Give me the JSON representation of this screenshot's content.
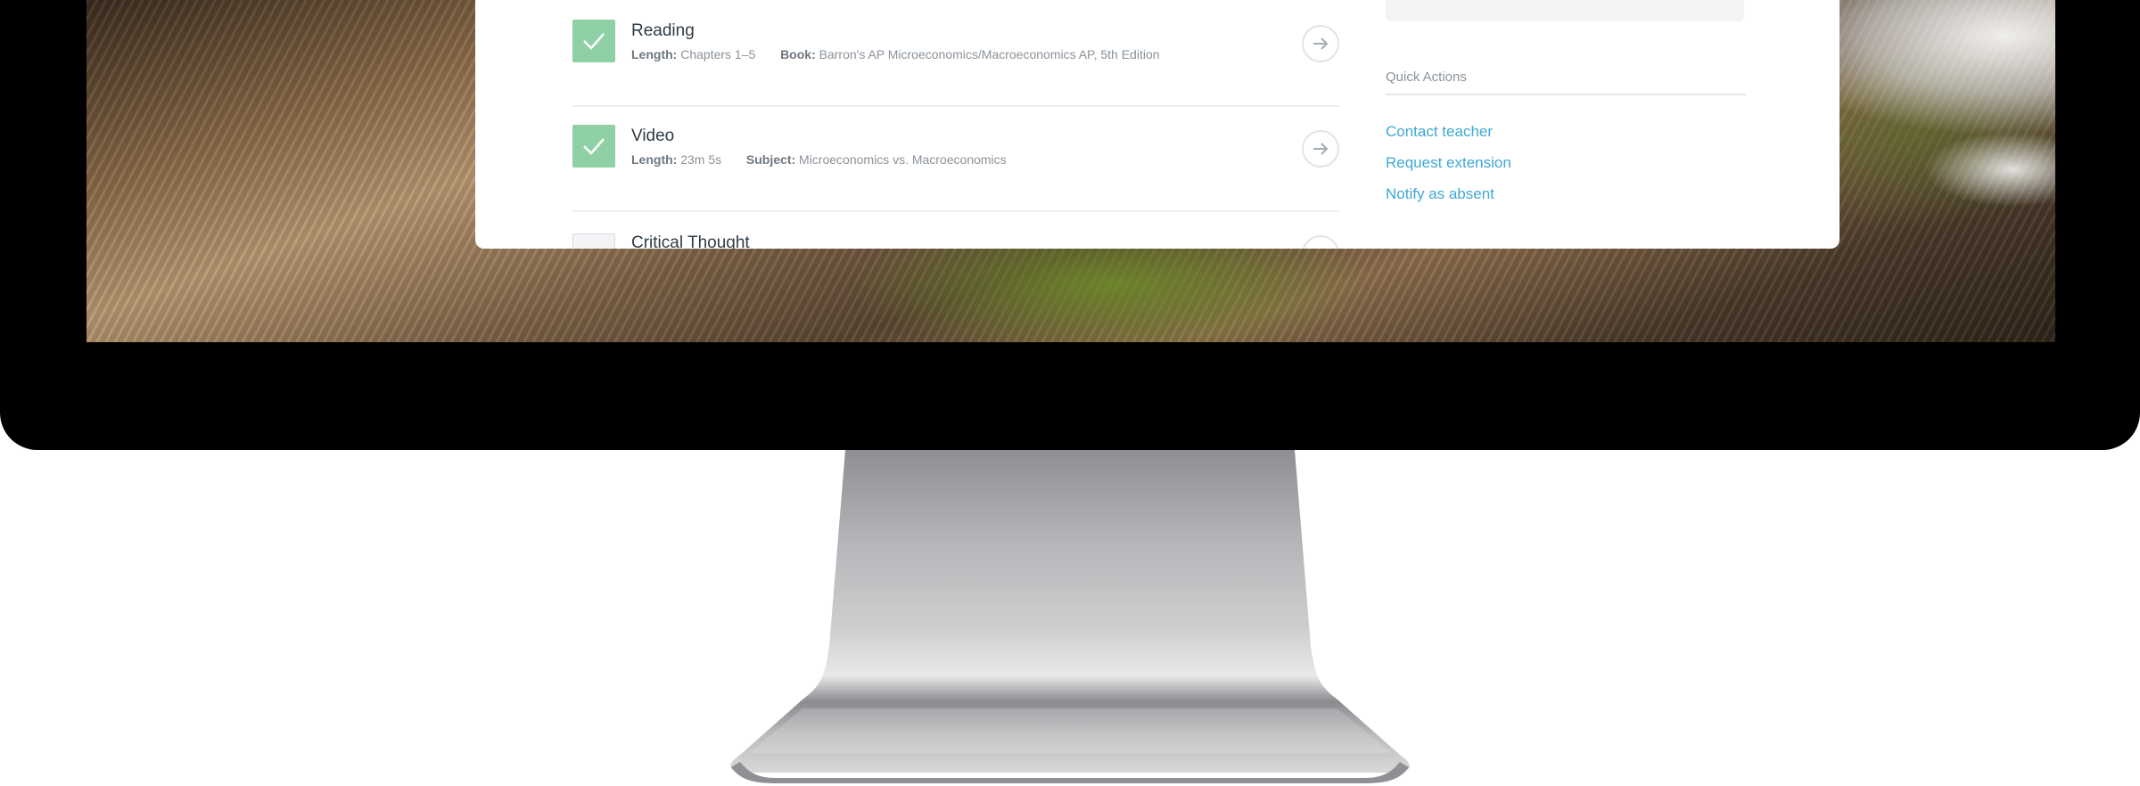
{
  "tasks": [
    {
      "title": "Reading",
      "completed": true,
      "meta": [
        {
          "label": "Length:",
          "value": "Chapters 1–5"
        },
        {
          "label": "Book:",
          "value": "Barron's AP Microeconomics/Macroeconomics AP, 5th Edition"
        }
      ]
    },
    {
      "title": "Video",
      "completed": true,
      "meta": [
        {
          "label": "Length:",
          "value": "23m 5s"
        },
        {
          "label": "Subject:",
          "value": "Microeconomics vs. Macroeconomics"
        }
      ]
    },
    {
      "title": "Critical Thought",
      "completed": false
    }
  ],
  "quick_actions": {
    "heading": "Quick Actions",
    "links": [
      "Contact teacher",
      "Request extension",
      "Notify as absent"
    ]
  },
  "colors": {
    "link": "#3fa7d6",
    "check": "#8fd0a5"
  }
}
